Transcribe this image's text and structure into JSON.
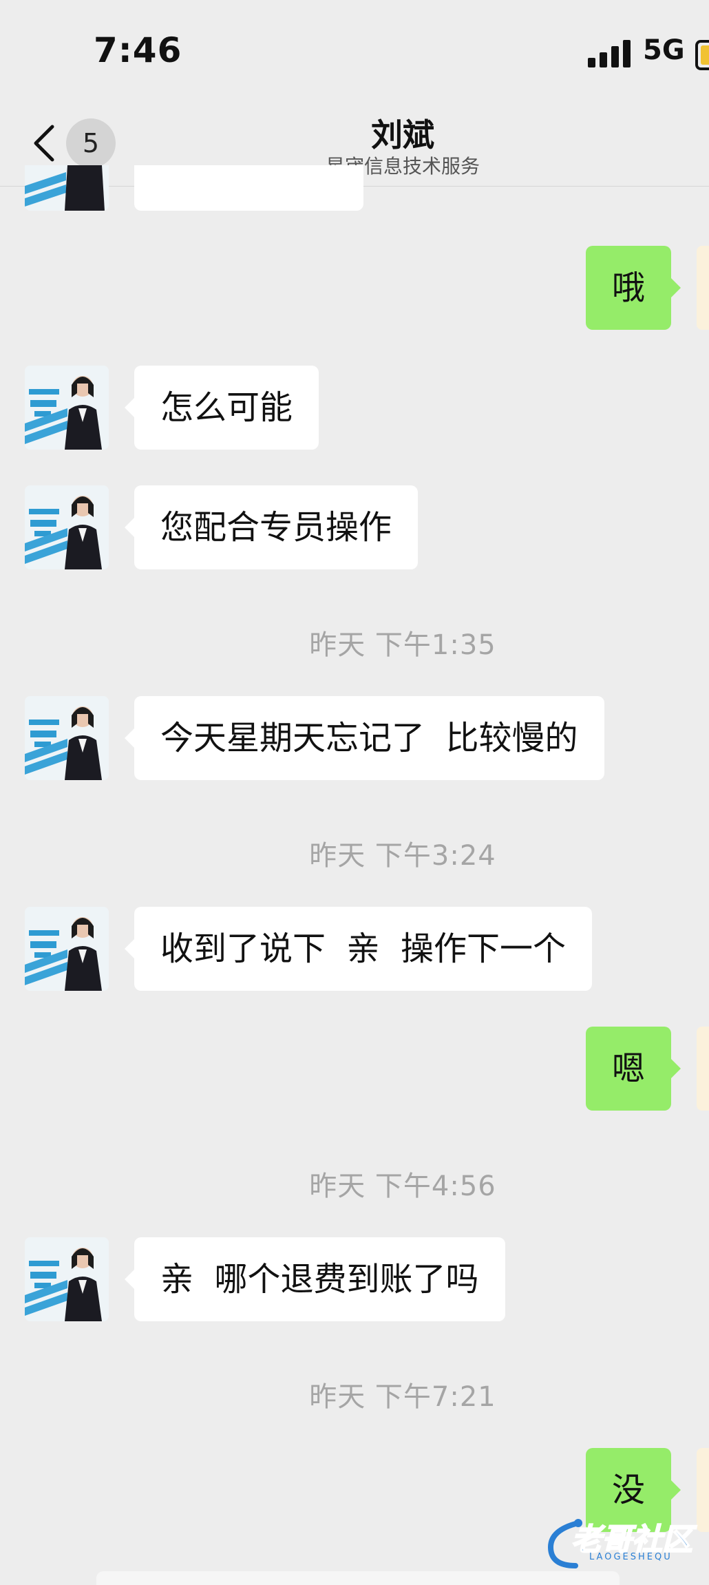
{
  "status_bar": {
    "time": "7:46",
    "network": "5G"
  },
  "nav": {
    "unread_count": "5",
    "title": "刘斌",
    "subtitle": "星宬信息技术服务"
  },
  "messages": [
    {
      "side": "right",
      "text": "哦"
    },
    {
      "side": "left",
      "text": "怎么可能"
    },
    {
      "side": "left",
      "text": "您配合专员操作"
    },
    {
      "type": "time",
      "text": "昨天 下午1:35"
    },
    {
      "side": "left",
      "text": "今天星期天忘记了  比较慢的"
    },
    {
      "type": "time",
      "text": "昨天 下午3:24"
    },
    {
      "side": "left",
      "text": "收到了说下  亲  操作下一个"
    },
    {
      "side": "right",
      "text": "嗯"
    },
    {
      "type": "time",
      "text": "昨天 下午4:56"
    },
    {
      "side": "left",
      "text": "亲  哪个退费到账了吗"
    },
    {
      "type": "time",
      "text": "昨天 下午7:21"
    },
    {
      "side": "right",
      "text": "没"
    }
  ],
  "watermark": {
    "text": "老哥社区",
    "sub": "LAOGESHEQU"
  }
}
